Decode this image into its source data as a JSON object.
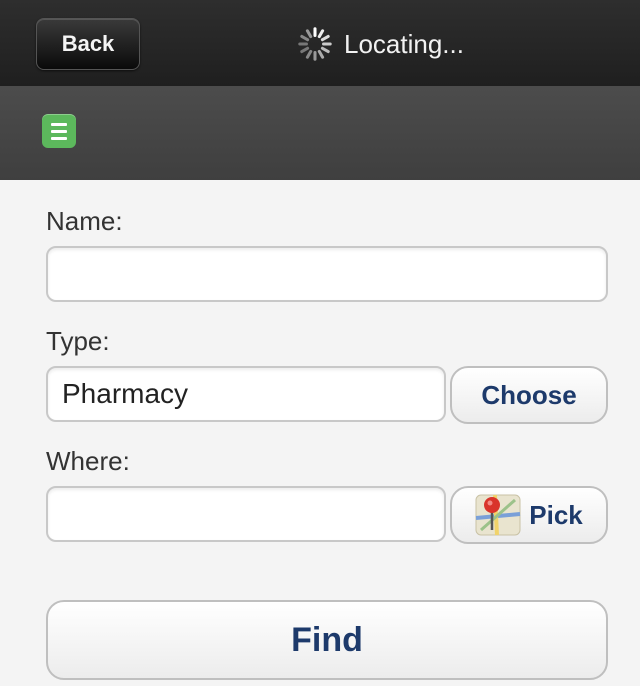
{
  "navbar": {
    "back_label": "Back",
    "status_text": "Locating..."
  },
  "form": {
    "name_label": "Name:",
    "name_value": "",
    "type_label": "Type:",
    "type_value": "Pharmacy",
    "choose_label": "Choose",
    "where_label": "Where:",
    "where_value": "",
    "pick_label": "Pick",
    "find_label": "Find"
  },
  "icons": {
    "menu": "menu-icon",
    "spinner": "loading-spinner-icon",
    "map_pin": "map-pin-icon"
  },
  "colors": {
    "navbar": "#222222",
    "subbar": "#444444",
    "menu_accent": "#5cb85c",
    "button_text": "#1d3a6b"
  }
}
